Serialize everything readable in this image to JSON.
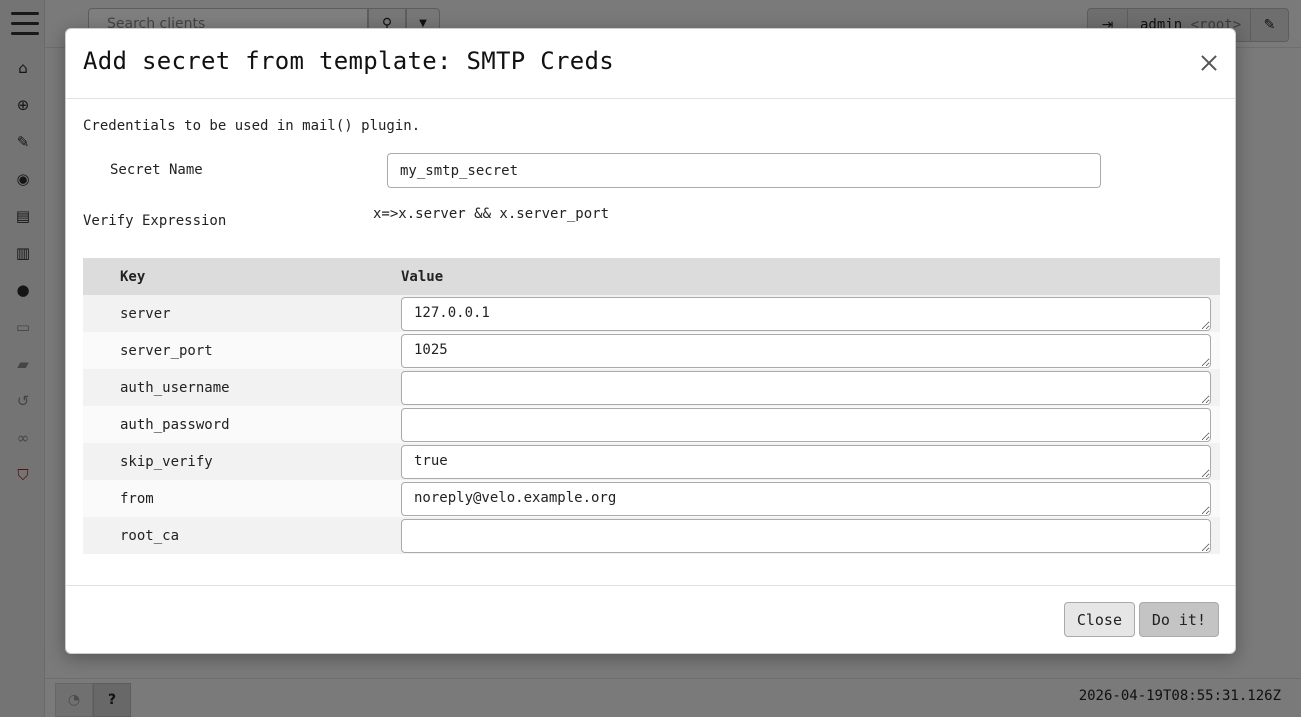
{
  "topbar": {
    "search_placeholder": "Search clients",
    "user": "admin",
    "user_org": "<root>"
  },
  "footer": {
    "timestamp": "2026-04-19T08:55:31.126Z"
  },
  "modal": {
    "title": "Add secret from template: SMTP Creds",
    "description": "Credentials to be used in mail() plugin.",
    "secret_name_label": "Secret Name",
    "secret_name_value": "my_smtp_secret",
    "verify_label": "Verify Expression",
    "verify_value": "x=>x.server && x.server_port",
    "table": {
      "key_header": "Key",
      "value_header": "Value",
      "rows": [
        {
          "key": "server",
          "value": "127.0.0.1"
        },
        {
          "key": "server_port",
          "value": "1025"
        },
        {
          "key": "auth_username",
          "value": ""
        },
        {
          "key": "auth_password",
          "value": ""
        },
        {
          "key": "skip_verify",
          "value": "true"
        },
        {
          "key": "from",
          "value": "noreply@velo.example.org"
        },
        {
          "key": "root_ca",
          "value": ""
        }
      ]
    },
    "close_label": "Close",
    "submit_label": "Do it!"
  }
}
